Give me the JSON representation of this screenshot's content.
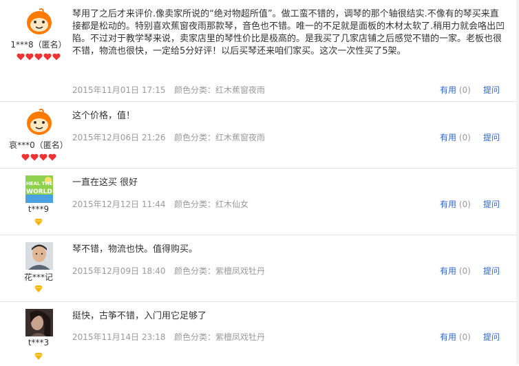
{
  "reviews": [
    {
      "avatar_icon": "orange-taobao-doll-avatar",
      "user": "1***8（匿名）",
      "rank_icon": "red-heart-icon",
      "rank_count": 5,
      "content": "琴用了之后才来评价.像卖家所说的“绝对物超所值”。做工蛮不错的，调琴的那个轴很结实.不像有的琴买来直接都是松动的。特别喜欢蕉窗夜雨那款琴，音色也不错。唯一的不足就是面板的木材太软了.稍用力就会咯出凹陷。不过对于教学琴来说，卖家店里的琴性价比是极高的。是我买了几家店铺之后感觉不错的一家。老板也很不错，物流也很快，一定给5分好评！以后买琴还来咱们家买。这次一次性买了5架。",
      "date": "2015年11月01日 17:15",
      "color": "颜色分类：红木蕉窗夜雨",
      "useful_label": "有用",
      "useful_count": "(0)",
      "ask_label": "提问"
    },
    {
      "avatar_icon": "orange-taobao-doll-avatar",
      "user": "哀***0（匿名）",
      "rank_icon": "red-heart-icon",
      "rank_count": 4,
      "content": "这个价格，值！",
      "date": "2015年12月06日 21:26",
      "color": "颜色分类：红木蕉窗夜雨",
      "useful_label": "有用",
      "useful_count": "(0)",
      "ask_label": "提问"
    },
    {
      "avatar_icon": "heal-the-world-avatar",
      "avatar_text": "HEAL THE WORLD",
      "user": "t***9",
      "rank_icon": "yellow-diamond-icon",
      "rank_count": 1,
      "content": "一直在这买 很好",
      "date": "2015年12月12日 11:44",
      "color": "颜色分类：红木仙女",
      "useful_label": "有用",
      "useful_count": "(0)",
      "ask_label": "提问"
    },
    {
      "avatar_icon": "user-photo-avatar",
      "user": "花***记",
      "rank_icon": "yellow-diamond-icon",
      "rank_count": 1,
      "content": "琴不错，物流也快。值得购买。",
      "date": "2015年12月09日 18:40",
      "color": "颜色分类：紫檀凤戏牡丹",
      "useful_label": "有用",
      "useful_count": "(0)",
      "ask_label": "提问"
    },
    {
      "avatar_icon": "dark-photo-avatar",
      "user": "t***3",
      "rank_icon": "yellow-diamond-icon",
      "rank_count": 1,
      "content": "挺快，古筝不错，入门用它足够了",
      "date": "2015年11月14日 23:18",
      "color": "颜色分类：紫檀凤戏牡丹",
      "useful_label": "有用",
      "useful_count": "(0)",
      "ask_label": "提问"
    }
  ]
}
